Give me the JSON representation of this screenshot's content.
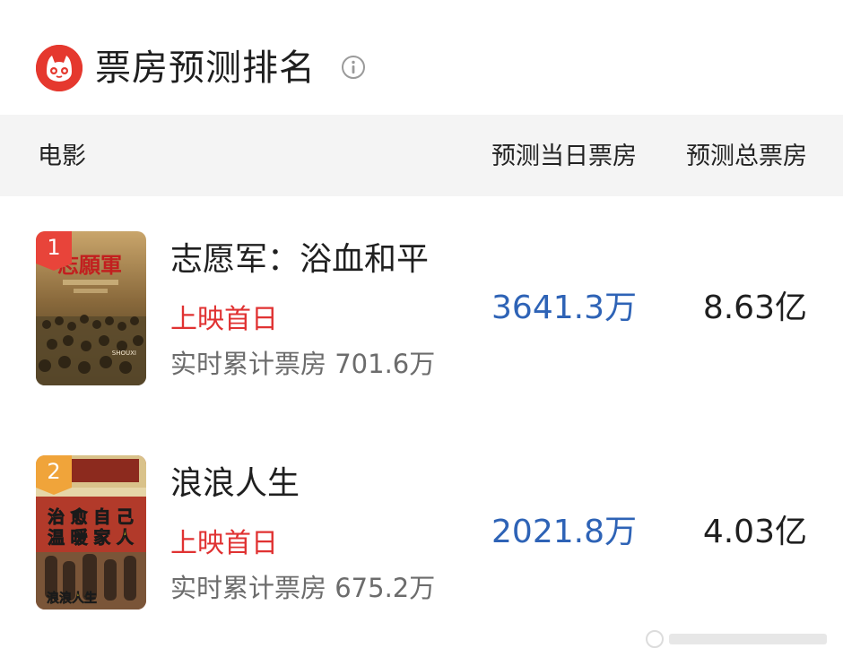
{
  "header": {
    "title": "票房预测排名",
    "logo_icon": "cat-logo-icon",
    "info_icon": "info-icon"
  },
  "columns": {
    "movie": "电影",
    "day_box": "预测当日票房",
    "total_box": "预测总票房"
  },
  "movies": [
    {
      "rank": "1",
      "title": "志愿军：浴血和平",
      "status": "上映首日",
      "cumulative": "实时累计票房 701.6万",
      "day_box": "3641.3万",
      "total_box": "8.63亿",
      "badge_color": "#e8443a",
      "poster_text": "志願軍",
      "poster_logo": "SHOUXI"
    },
    {
      "rank": "2",
      "title": "浪浪人生",
      "status": "上映首日",
      "cumulative": "实时累计票房 675.2万",
      "day_box": "2021.8万",
      "total_box": "4.03亿",
      "badge_color": "#f0a43a",
      "poster_text_lines": [
        "治 愈 自 己",
        "温 暖 家 人"
      ],
      "poster_logo": "浪浪人生"
    }
  ],
  "colors": {
    "accent_blue": "#2e63b6",
    "status_red": "#e03232",
    "header_bg": "#f4f4f4"
  }
}
